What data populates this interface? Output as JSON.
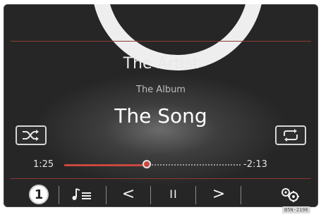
{
  "now_playing": {
    "artist": "The Artist",
    "album": "The Album",
    "song": "The Song"
  },
  "progress": {
    "elapsed": "1:25",
    "remaining": "-2:13",
    "fraction": 0.47
  },
  "controls": {
    "callout": "1",
    "previous_glyph": "<",
    "pause_glyph": "II",
    "next_glyph": ">"
  },
  "icons": {
    "shuffle": "shuffle-icon",
    "repeat": "repeat-icon",
    "playlist": "music-list-icon",
    "settings": "settings-icon"
  },
  "colors": {
    "accent": "#c9473e",
    "screen_bg": "#2b2b2b",
    "text": "#e8e8e8"
  },
  "figure_code": "B5N-2196"
}
